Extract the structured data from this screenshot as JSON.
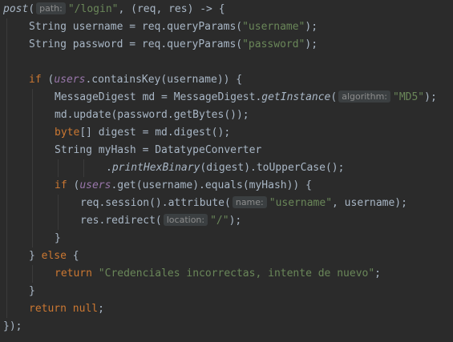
{
  "editor": {
    "colors": {
      "background": "#2b2b2b",
      "text": "#a9b7c6",
      "keyword": "#cc7832",
      "string": "#6a8759",
      "field": "#9876aa",
      "hint_bg": "#3b3f41",
      "hint_text": "#8c8c8c"
    },
    "lines": [
      {
        "indent": 0,
        "tokens": [
          {
            "t": "fn",
            "v": "post"
          },
          {
            "t": "plain",
            "v": "("
          },
          {
            "t": "hint",
            "v": "path:"
          },
          {
            "t": "str",
            "v": "\"/login\""
          },
          {
            "t": "plain",
            "v": ", (req, res) -> {"
          }
        ]
      },
      {
        "indent": 1,
        "tokens": [
          {
            "t": "plain",
            "v": "String username = req.queryParams("
          },
          {
            "t": "str",
            "v": "\"username\""
          },
          {
            "t": "plain",
            "v": ");"
          }
        ]
      },
      {
        "indent": 1,
        "tokens": [
          {
            "t": "plain",
            "v": "String password = req.queryParams("
          },
          {
            "t": "str",
            "v": "\"password\""
          },
          {
            "t": "plain",
            "v": ");"
          }
        ]
      },
      {
        "indent": 0,
        "tokens": []
      },
      {
        "indent": 1,
        "tokens": [
          {
            "t": "kw",
            "v": "if "
          },
          {
            "t": "plain",
            "v": "("
          },
          {
            "t": "fld",
            "v": "users"
          },
          {
            "t": "plain",
            "v": ".containsKey(username)) {"
          }
        ]
      },
      {
        "indent": 2,
        "tokens": [
          {
            "t": "plain",
            "v": "MessageDigest md = MessageDigest."
          },
          {
            "t": "fn",
            "v": "getInstance"
          },
          {
            "t": "plain",
            "v": "("
          },
          {
            "t": "hint",
            "v": "algorithm:"
          },
          {
            "t": "str",
            "v": "\"MD5\""
          },
          {
            "t": "plain",
            "v": ");"
          }
        ]
      },
      {
        "indent": 2,
        "tokens": [
          {
            "t": "plain",
            "v": "md.update(password.getBytes());"
          }
        ]
      },
      {
        "indent": 2,
        "tokens": [
          {
            "t": "kw",
            "v": "byte"
          },
          {
            "t": "plain",
            "v": "[] digest = md.digest();"
          }
        ]
      },
      {
        "indent": 2,
        "tokens": [
          {
            "t": "plain",
            "v": "String myHash = DatatypeConverter"
          }
        ]
      },
      {
        "indent": 4,
        "tokens": [
          {
            "t": "plain",
            "v": "."
          },
          {
            "t": "fn",
            "v": "printHexBinary"
          },
          {
            "t": "plain",
            "v": "(digest).toUpperCase();"
          }
        ]
      },
      {
        "indent": 2,
        "tokens": [
          {
            "t": "kw",
            "v": "if "
          },
          {
            "t": "plain",
            "v": "("
          },
          {
            "t": "fld",
            "v": "users"
          },
          {
            "t": "plain",
            "v": ".get(username).equals(myHash)) {"
          }
        ]
      },
      {
        "indent": 3,
        "tokens": [
          {
            "t": "plain",
            "v": "req.session().attribute("
          },
          {
            "t": "hint",
            "v": "name:"
          },
          {
            "t": "str",
            "v": "\"username\""
          },
          {
            "t": "plain",
            "v": ", username);"
          }
        ]
      },
      {
        "indent": 3,
        "tokens": [
          {
            "t": "plain",
            "v": "res.redirect("
          },
          {
            "t": "hint",
            "v": "location:"
          },
          {
            "t": "str",
            "v": "\"/\""
          },
          {
            "t": "plain",
            "v": ");"
          }
        ]
      },
      {
        "indent": 2,
        "tokens": [
          {
            "t": "plain",
            "v": "}"
          }
        ]
      },
      {
        "indent": 1,
        "tokens": [
          {
            "t": "plain",
            "v": "} "
          },
          {
            "t": "kw",
            "v": "else "
          },
          {
            "t": "plain",
            "v": "{"
          }
        ]
      },
      {
        "indent": 2,
        "tokens": [
          {
            "t": "kw",
            "v": "return "
          },
          {
            "t": "str",
            "v": "\"Credenciales incorrectas, intente de nuevo\""
          },
          {
            "t": "plain",
            "v": ";"
          }
        ]
      },
      {
        "indent": 1,
        "tokens": [
          {
            "t": "plain",
            "v": "}"
          }
        ]
      },
      {
        "indent": 1,
        "tokens": [
          {
            "t": "kw",
            "v": "return null"
          },
          {
            "t": "plain",
            "v": ";"
          }
        ]
      },
      {
        "indent": 0,
        "tokens": [
          {
            "t": "plain",
            "v": "});"
          }
        ]
      }
    ]
  }
}
